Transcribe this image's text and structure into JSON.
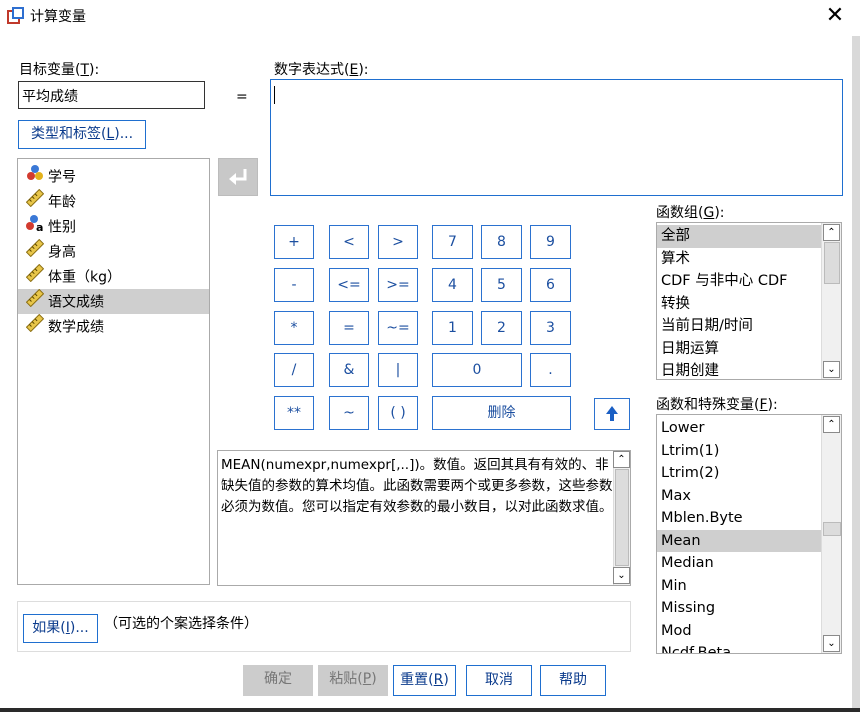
{
  "window": {
    "title": "计算变量",
    "close_label": "✕"
  },
  "target_var": {
    "label": "目标变量(",
    "label_key": "T",
    "label_end": "):",
    "value": "平均成绩"
  },
  "equals": "=",
  "type_label_btn": {
    "pre": "类型和标签(",
    "key": "L",
    "post": ")..."
  },
  "expression": {
    "label": "数字表达式(",
    "label_key": "E",
    "label_end": "):",
    "value": ""
  },
  "variables": [
    {
      "name": "学号",
      "icon": "nominal-icon",
      "selected": false
    },
    {
      "name": "年龄",
      "icon": "scale-ruler-icon",
      "selected": false
    },
    {
      "name": "性别",
      "icon": "nominal-string-icon",
      "selected": false
    },
    {
      "name": "身高",
      "icon": "scale-ruler-icon",
      "selected": false
    },
    {
      "name": "体重（kg）",
      "icon": "scale-ruler-icon",
      "selected": false
    },
    {
      "name": "语文成绩",
      "icon": "scale-ruler-icon",
      "selected": true
    },
    {
      "name": "数学成绩",
      "icon": "scale-ruler-icon",
      "selected": false
    }
  ],
  "keypad": {
    "row1": [
      "+",
      "<",
      ">",
      "7",
      "8",
      "9"
    ],
    "row2": [
      "-",
      "<=",
      ">=",
      "4",
      "5",
      "6"
    ],
    "row3": [
      "*",
      "=",
      "~=",
      "1",
      "2",
      "3"
    ],
    "row4": [
      "/",
      "&",
      "|",
      "0",
      "."
    ],
    "row5": [
      "**",
      "~",
      "( )",
      "删除"
    ]
  },
  "description": "MEAN(numexpr,numexpr[,..])。数值。返回其具有有效的、非缺失值的参数的算术均值。此函数需要两个或更多参数，这些参数必须为数值。您可以指定有效参数的最小数目，以对此函数求值。",
  "function_group": {
    "label": "函数组(",
    "label_key": "G",
    "label_end": "):",
    "items": [
      "全部",
      "算术",
      "CDF 与非中心 CDF",
      "转换",
      "当前日期/时间",
      "日期运算",
      "日期创建"
    ],
    "selected": "全部"
  },
  "functions": {
    "label": "函数和特殊变量(",
    "label_key": "F",
    "label_end": "):",
    "items": [
      "Lower",
      "Ltrim(1)",
      "Ltrim(2)",
      "Max",
      "Mblen.Byte",
      "Mean",
      "Median",
      "Min",
      "Missing",
      "Mod",
      "Ncdf.Beta"
    ],
    "selected": "Mean"
  },
  "if_section": {
    "btn_pre": "如果(",
    "btn_key": "I",
    "btn_post": ")...",
    "hint": "（可选的个案选择条件）"
  },
  "buttons": {
    "ok": "确定",
    "paste": {
      "pre": "粘贴(",
      "key": "P",
      "post": ")"
    },
    "reset": {
      "pre": "重置(",
      "key": "R",
      "post": ")"
    },
    "cancel": "取消",
    "help": "帮助"
  },
  "colors": {
    "accent": "#1f6fcf",
    "selection": "#cfcfcf",
    "disabled_btn": "#cccccc"
  }
}
